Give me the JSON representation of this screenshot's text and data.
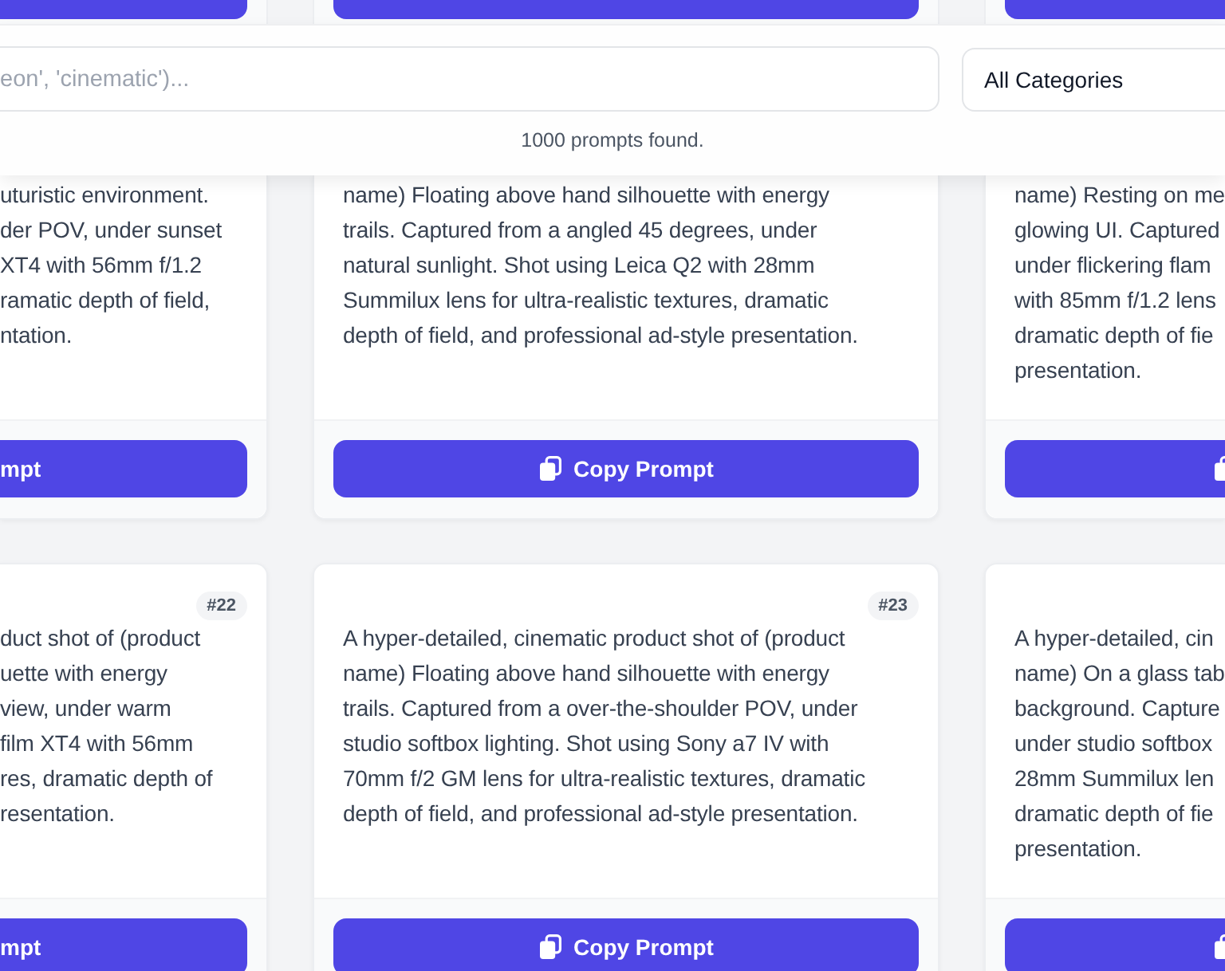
{
  "cards_above": [
    {
      "cut_left": true,
      "cut_right": false
    },
    {
      "cut_left": false,
      "cut_right": false
    },
    {
      "cut_left": false,
      "cut_right": true
    }
  ],
  "search_panel": {
    "search": {
      "placeholder": "eon', 'cinematic')..."
    },
    "category": {
      "value": "All Categories"
    },
    "result_count": "1000 prompts found."
  },
  "card_rows": [
    {
      "kind": "under-panel",
      "cards": [
        {
          "cut_left": true,
          "cut_right": false,
          "lines": [
            "uturistic environment.",
            "der POV, under sunset",
            "XT4 with 56mm f/1.2",
            "ramatic depth of field,",
            "ntation."
          ],
          "button": {
            "label": "mpt"
          }
        },
        {
          "cut_left": false,
          "cut_right": false,
          "lines": [
            "name) Floating above hand silhouette with energy",
            "trails. Captured from a angled 45 degrees, under",
            "natural sunlight. Shot using Leica Q2 with 28mm",
            "Summilux lens for ultra-realistic textures, dramatic",
            "depth of field, and professional ad-style presentation."
          ],
          "button": {
            "label": "Copy Prompt"
          }
        },
        {
          "cut_left": false,
          "cut_right": true,
          "lines": [
            "name) Resting on me",
            "glowing UI. Captured",
            "under flickering flam",
            "with 85mm f/1.2 lens",
            "dramatic depth of fie",
            "presentation."
          ]
        }
      ]
    },
    {
      "kind": "full",
      "cards": [
        {
          "cut_left": true,
          "cut_right": false,
          "number": "#22",
          "lines": [
            "duct shot of (product",
            "uette with energy",
            "view, under warm",
            "film XT4 with 56mm",
            "res, dramatic depth of",
            "resentation."
          ],
          "button": {
            "label": "mpt"
          }
        },
        {
          "cut_left": false,
          "cut_right": false,
          "number": "#23",
          "lines": [
            "A hyper-detailed, cinematic product shot of (product",
            "name) Floating above hand silhouette with energy",
            "trails. Captured from a over-the-shoulder POV, under",
            "studio softbox lighting. Shot using Sony a7 IV with",
            "70mm f/2 GM lens for ultra-realistic textures, dramatic",
            "depth of field, and professional ad-style presentation."
          ],
          "button": {
            "label": "Copy Prompt"
          }
        },
        {
          "cut_left": false,
          "cut_right": true,
          "lines": [
            "A hyper-detailed, cin",
            "name) On a glass tab",
            "background. Capture",
            "under studio softbox",
            "28mm Summilux len",
            "dramatic depth of fie",
            "presentation."
          ]
        }
      ]
    }
  ]
}
